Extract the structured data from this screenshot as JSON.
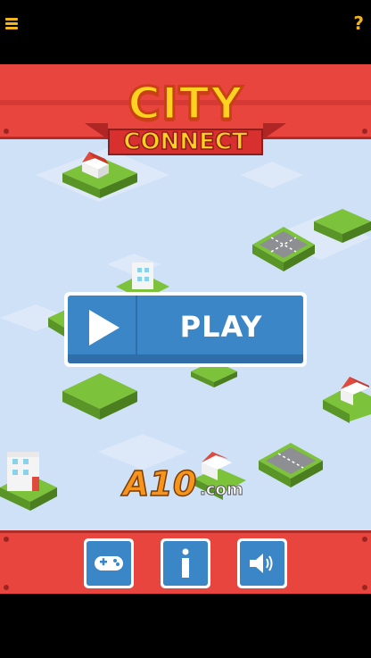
{
  "header": {
    "menu_icon": "hamburger-menu-icon",
    "help_label": "?"
  },
  "title": {
    "line1": "CITY",
    "line2": "CONNECT"
  },
  "play_button": {
    "label": "PLAY",
    "icon": "play-triangle-icon"
  },
  "sponsor": {
    "brand": "A10",
    "domain": ".com"
  },
  "bottom_buttons": [
    {
      "icon": "gamepad-icon"
    },
    {
      "icon": "info-icon"
    },
    {
      "icon": "speaker-icon"
    }
  ],
  "colors": {
    "banner_red": "#e8453e",
    "button_blue": "#3b86c6",
    "title_yellow": "#ffd21f",
    "sky_blue": "#cfe1f7",
    "grass_green": "#7cc23a"
  }
}
